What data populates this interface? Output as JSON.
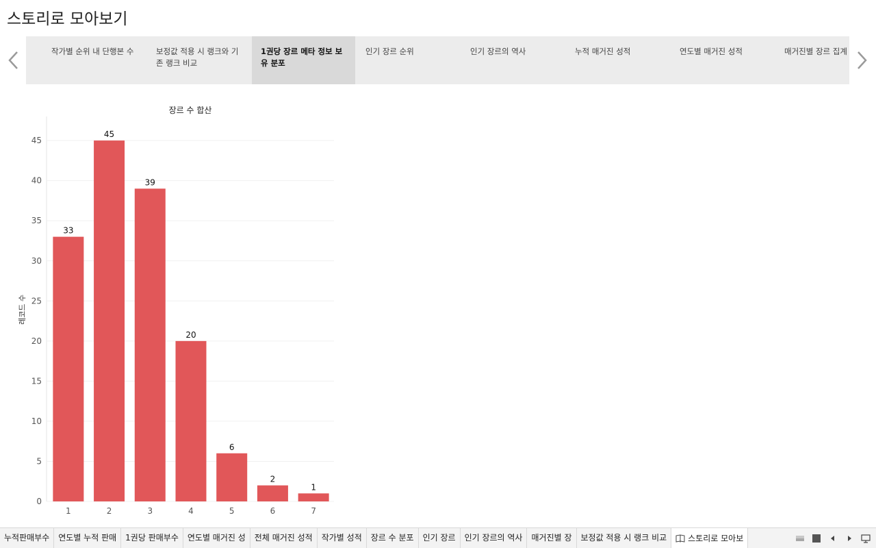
{
  "story": {
    "title": "스토리로 모아보기"
  },
  "story_points": [
    {
      "label": ""
    },
    {
      "label": "작가별 순위 내 단행본 수"
    },
    {
      "label": "보정값 적용 시 랭크와 기존 랭크 비교"
    },
    {
      "label": "1권당 장르 메타 정보 보유 분포"
    },
    {
      "label": "인기 장르 순위"
    },
    {
      "label": "인기 장르의 역사"
    },
    {
      "label": "누적 매거진 성적"
    },
    {
      "label": "연도별 매거진 성적"
    },
    {
      "label": "매거진별 장르 집계"
    }
  ],
  "active_story_point": 3,
  "chart_data": {
    "type": "bar",
    "title": "장르 수 합산",
    "ylabel": "레코드 수",
    "xlabel": "",
    "categories": [
      "1",
      "2",
      "3",
      "4",
      "5",
      "6",
      "7"
    ],
    "values": [
      33,
      45,
      39,
      20,
      6,
      2,
      1
    ],
    "ylim": [
      0,
      48
    ],
    "yticks": [
      0,
      5,
      10,
      15,
      20,
      25,
      30,
      35,
      40,
      45
    ],
    "bar_color": "#e15759",
    "grid": true
  },
  "sheet_tabs": [
    {
      "label": "누적판매부수"
    },
    {
      "label": "연도별 누적 판매"
    },
    {
      "label": "1권당 판매부수"
    },
    {
      "label": "연도별 매거진 성"
    },
    {
      "label": "전체 매거진 성적"
    },
    {
      "label": "작가별 성적"
    },
    {
      "label": "장르 수 분포"
    },
    {
      "label": "인기 장르"
    },
    {
      "label": "인기 장르의 역사"
    },
    {
      "label": "매거진별 장"
    },
    {
      "label": "보정값 적용 시 랭크 비교"
    },
    {
      "label": "스토리로 모아보"
    }
  ],
  "icons": {
    "prev_story": "chevron-left-icon",
    "next_story": "chevron-right-icon",
    "story_tab": "book-icon",
    "grid_view": "grid-icon",
    "single_view": "square-icon",
    "prev_sheet": "caret-left-icon",
    "next_sheet": "caret-right-icon",
    "present": "presentation-icon"
  }
}
